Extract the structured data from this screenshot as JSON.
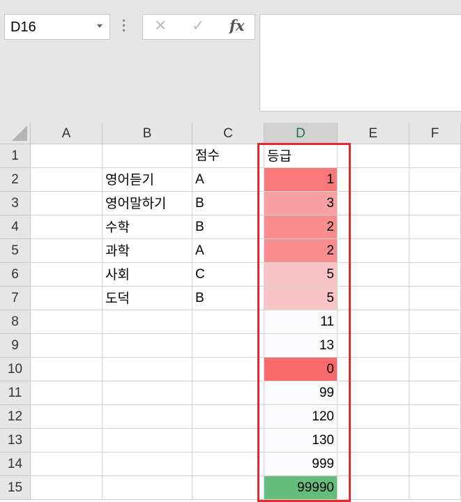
{
  "name_box": {
    "value": "D16"
  },
  "formula_bar": {
    "cancel_icon": "x-icon",
    "enter_icon": "check-icon",
    "function_label": "fx",
    "value": ""
  },
  "columns": [
    "A",
    "B",
    "C",
    "D",
    "E",
    "F"
  ],
  "selected_column": "D",
  "rows": [
    {
      "num": "1",
      "B": "",
      "C": "점수",
      "D": "등급",
      "D_color": "#ffffff"
    },
    {
      "num": "2",
      "B": "영어듣기",
      "C": "A",
      "D": "1",
      "D_color": "#f8797a"
    },
    {
      "num": "3",
      "B": "영어말하기",
      "C": "B",
      "D": "3",
      "D_color": "#f9a0a2"
    },
    {
      "num": "4",
      "B": "수학",
      "C": "B",
      "D": "2",
      "D_color": "#f88d8e"
    },
    {
      "num": "5",
      "B": "과학",
      "C": "A",
      "D": "2",
      "D_color": "#f88d8e"
    },
    {
      "num": "6",
      "B": "사회",
      "C": "C",
      "D": "5",
      "D_color": "#f9c4c6"
    },
    {
      "num": "7",
      "B": "도덕",
      "C": "B",
      "D": "5",
      "D_color": "#f9c4c6"
    },
    {
      "num": "8",
      "B": "",
      "C": "",
      "D": "11",
      "D_color": "#fbfbfd"
    },
    {
      "num": "9",
      "B": "",
      "C": "",
      "D": "13",
      "D_color": "#fbfbfd"
    },
    {
      "num": "10",
      "B": "",
      "C": "",
      "D": "0",
      "D_color": "#f8696b"
    },
    {
      "num": "11",
      "B": "",
      "C": "",
      "D": "99",
      "D_color": "#fbfbfd"
    },
    {
      "num": "12",
      "B": "",
      "C": "",
      "D": "120",
      "D_color": "#fbfbfd"
    },
    {
      "num": "13",
      "B": "",
      "C": "",
      "D": "130",
      "D_color": "#fbfbfd"
    },
    {
      "num": "14",
      "B": "",
      "C": "",
      "D": "999",
      "D_color": "#fbfbfd"
    },
    {
      "num": "15",
      "B": "",
      "C": "",
      "D": "99990",
      "D_color": "#63be7b"
    }
  ],
  "highlight_color": "#e02a30"
}
